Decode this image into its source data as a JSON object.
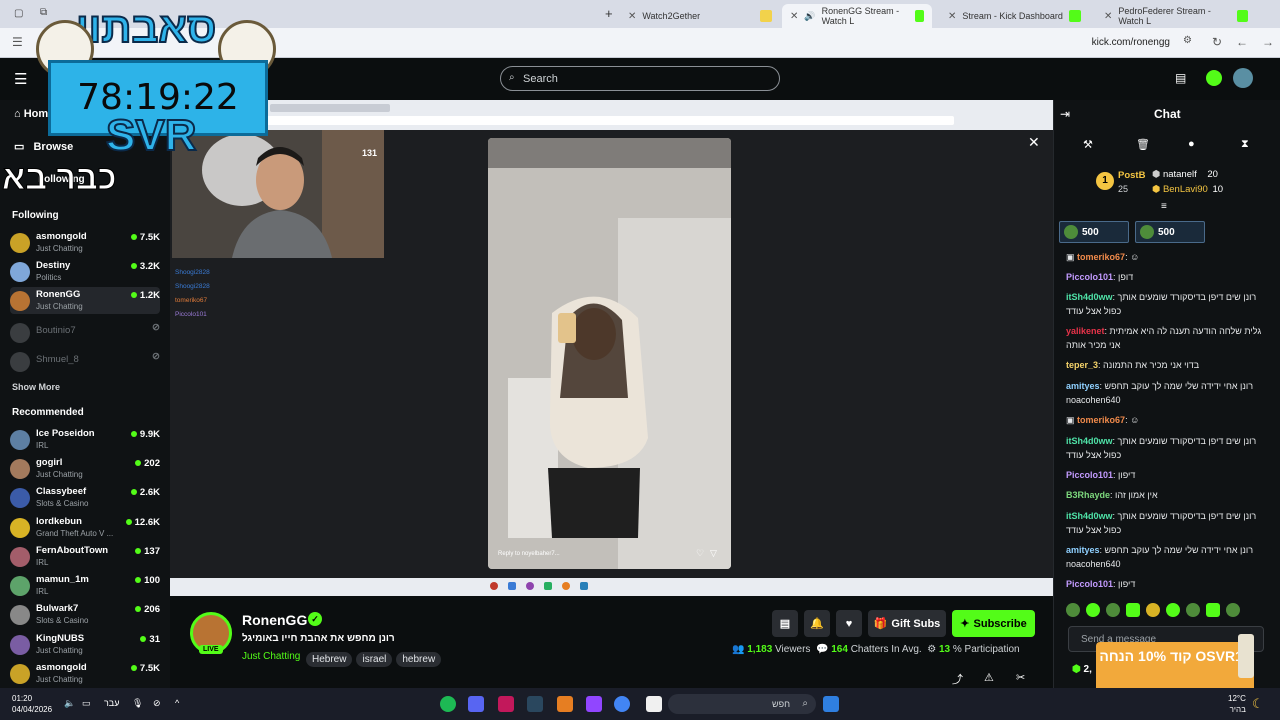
{
  "browser": {
    "tabs": [
      {
        "label": "Watch2Gether"
      },
      {
        "label": "RonenGG Stream - Watch L"
      },
      {
        "label": "Stream - Kick Dashboard"
      },
      {
        "label": "PedroFederer Stream - Watch L"
      }
    ],
    "url": "kick.com/ronengg"
  },
  "overlay": {
    "brand_text": "סאבתון",
    "timer": "78:19:22",
    "svr": "SVR",
    "hebrew_line": "כבר בא"
  },
  "header": {
    "search_placeholder": "Search"
  },
  "sidebar": {
    "nav": [
      {
        "label": "Home"
      },
      {
        "label": "Browse"
      },
      {
        "label": "Following"
      }
    ],
    "following_title": "Following",
    "following": [
      {
        "name": "asmongold",
        "category": "Just Chatting",
        "viewers": "7.5K",
        "color": "#c9a227"
      },
      {
        "name": "Destiny",
        "category": "Politics",
        "viewers": "3.2K",
        "color": "#7fa7d9"
      },
      {
        "name": "RonenGG",
        "category": "Just Chatting",
        "viewers": "1.2K",
        "color": "#b87333"
      },
      {
        "name": "Boutinio7",
        "category": "",
        "viewers": "",
        "color": "#555"
      },
      {
        "name": "Shmuel_8",
        "category": "",
        "viewers": "",
        "color": "#555"
      }
    ],
    "show_more": "Show More",
    "recommended_title": "Recommended",
    "recommended": [
      {
        "name": "Ice Poseidon",
        "category": "IRL",
        "viewers": "9.9K",
        "color": "#5d7fa3"
      },
      {
        "name": "gogirl",
        "category": "Just Chatting",
        "viewers": "202",
        "color": "#a37a5d"
      },
      {
        "name": "Classybeef",
        "category": "Slots & Casino",
        "viewers": "2.6K",
        "color": "#3b5ba8"
      },
      {
        "name": "lordkebun",
        "category": "Grand Theft Auto V ...",
        "viewers": "12.6K",
        "color": "#d8b325"
      },
      {
        "name": "FernAboutTown",
        "category": "IRL",
        "viewers": "137",
        "color": "#a35d6a"
      },
      {
        "name": "mamun_1m",
        "category": "IRL",
        "viewers": "100",
        "color": "#5da36a"
      },
      {
        "name": "Bulwark7",
        "category": "Slots & Casino",
        "viewers": "206",
        "color": "#888"
      },
      {
        "name": "KingNUBS",
        "category": "Just Chatting",
        "viewers": "31",
        "color": "#7a5da3"
      },
      {
        "name": "asmongold",
        "category": "Just Chatting",
        "viewers": "7.5K",
        "color": "#c9a227"
      }
    ]
  },
  "video": {
    "webcam_chat": [
      {
        "user": "Shoogi2828",
        "color": "#3a7bd5"
      },
      {
        "user": "Shoogi2828",
        "color": "#3a7bd5"
      },
      {
        "user": "tomeriko67",
        "color": "#e07b39"
      },
      {
        "user": "Piccolo101",
        "color": "#9b7bd8"
      }
    ],
    "phone_caption": "Reply to noyelbaher7..."
  },
  "stream": {
    "channel": "RonenGG",
    "title": "רונן מחפש את אהבת חייו באומיגל",
    "live_label": "LIVE",
    "category": "Just Chatting",
    "tags": [
      "Hebrew",
      "israel",
      "hebrew"
    ],
    "gift_label": "Gift Subs",
    "subscribe_label": "Subscribe",
    "viewers": "1,183",
    "viewers_label": "Viewers",
    "chatters": "164",
    "chatters_label": "Chatters In Avg.",
    "participation": "13",
    "participation_label": "% Participation"
  },
  "chat": {
    "title": "Chat",
    "leaderboard": [
      {
        "rank": "1",
        "name": "PostB",
        "value": "25"
      },
      {
        "name": "natanelf",
        "value": "20"
      },
      {
        "name": "BenLavi90",
        "value": "10"
      }
    ],
    "pinned": [
      {
        "value": "500"
      },
      {
        "value": "500"
      }
    ],
    "messages": [
      {
        "user": "tomeriko67",
        "text": "",
        "color": "#f08a4b"
      },
      {
        "user": "Piccolo101",
        "text": "דופן",
        "color": "#c39bff"
      },
      {
        "user": "itSh4d0ww",
        "text": "רונן שים דיפן בדיסקורד שומעים אותך כפול אצל עודד",
        "color": "#4fe3a8"
      },
      {
        "user": "yalikenet",
        "text": "גלית שלחה הודעה תענה לה היא אמיתית אני מכיר אותה",
        "color": "#e8334a"
      },
      {
        "user": "teper_3",
        "text": "בדוי אני מכיר את התמונה",
        "color": "#f5d36a"
      },
      {
        "user": "amityes",
        "text": "רונן אחי ידידה שלי שמה לך עוקב תחפש noacohen640",
        "color": "#8fd0ff"
      },
      {
        "user": "tomeriko67",
        "text": "",
        "color": "#f08a4b"
      },
      {
        "user": "itSh4d0ww",
        "text": "רונן שים דיפן בדיסקורד שומעים אותך כפול אצל עודד",
        "color": "#4fe3a8"
      },
      {
        "user": "Piccolo101",
        "text": "דיפון",
        "color": "#c39bff"
      },
      {
        "user": "B3Rhayde",
        "text": "אין אמון זהו",
        "color": "#7dd87d"
      },
      {
        "user": "itSh4d0ww",
        "text": "רונן שים דיפן בדיסקורד שומעים אותך כפול אצל עודד",
        "color": "#4fe3a8"
      },
      {
        "user": "amityes",
        "text": "רונן אחי ידידה שלי שמה לך עוקב תחפש noacohen640",
        "color": "#8fd0ff"
      },
      {
        "user": "Piccolo101",
        "text": "דיפון",
        "color": "#c39bff"
      }
    ],
    "input_placeholder": "Send a message",
    "points": "2,",
    "promo": "קוד 10% הנחה OSVR10"
  },
  "taskbar": {
    "time": "01:20",
    "date": "04/04/2026",
    "lang": "עבר",
    "search_placeholder": "חפש",
    "weather_temp": "12°C",
    "weather_desc": "בהיר"
  },
  "colors": {
    "kick_green": "#53fc18",
    "bg": "#0b0e0f",
    "panel": "#0f1214"
  }
}
